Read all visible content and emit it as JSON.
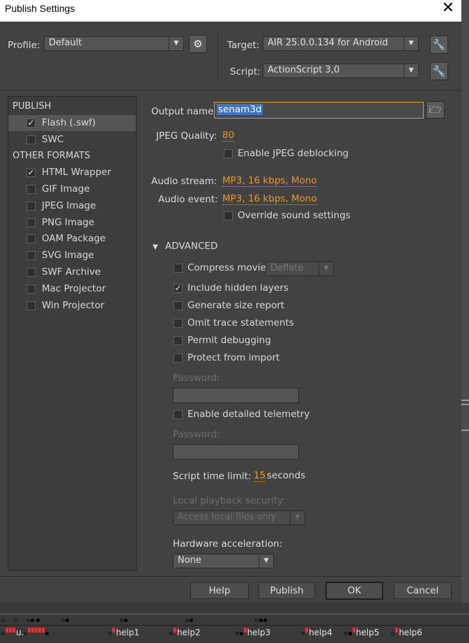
{
  "window": {
    "title": "Publish Settings"
  },
  "header": {
    "profile_label": "Profile:",
    "profile_value": "Default",
    "target_label": "Target:",
    "target_value": "AIR 25.0.0.134 for Android",
    "script_label": "Script:",
    "script_value": "ActionScript 3,0"
  },
  "sidebar": {
    "publish_heading": "PUBLISH",
    "other_heading": "OTHER FORMATS",
    "publish_items": [
      {
        "label": "Flash (.swf)",
        "checked": true,
        "selected": true
      },
      {
        "label": "SWC",
        "checked": false
      }
    ],
    "other_items": [
      {
        "label": "HTML Wrapper",
        "checked": true
      },
      {
        "label": "GIF Image",
        "checked": false
      },
      {
        "label": "JPEG Image",
        "checked": false
      },
      {
        "label": "PNG Image",
        "checked": false
      },
      {
        "label": "OAM Package",
        "checked": false
      },
      {
        "label": "SVG Image",
        "checked": false
      },
      {
        "label": "SWF Archive",
        "checked": false
      },
      {
        "label": "Mac Projector",
        "checked": false
      },
      {
        "label": "Win Projector",
        "checked": false
      }
    ]
  },
  "main": {
    "output_name_label": "Output name:",
    "output_name_value": "senam3d",
    "jpeg_quality_label": "JPEG Quality:",
    "jpeg_quality_value": "80",
    "jpeg_deblocking_label": "Enable JPEG deblocking",
    "audio_stream_label": "Audio stream:",
    "audio_stream_value": "MP3, 16 kbps, Mono",
    "audio_event_label": "Audio event:",
    "audio_event_value": "MP3, 16 kbps, Mono",
    "override_sound_label": "Override sound settings",
    "advanced_heading": "ADVANCED",
    "compress_movie_label": "Compress movie",
    "compress_movie_value": "Deflate",
    "options": [
      {
        "label": "Include hidden layers",
        "checked": true
      },
      {
        "label": "Generate size report",
        "checked": false
      },
      {
        "label": "Omit trace statements",
        "checked": false
      },
      {
        "label": "Permit debugging",
        "checked": false
      },
      {
        "label": "Protect from import",
        "checked": false
      }
    ],
    "password_label": "Password:",
    "telemetry_label": "Enable detailed telemetry",
    "password2_label": "Password:",
    "script_time_limit_label": "Script time limit:",
    "script_time_limit_value": "15",
    "script_time_limit_unit": "seconds",
    "local_playback_label": "Local playback security:",
    "local_playback_value": "Access local files only",
    "hw_accel_label": "Hardware acceleration:",
    "hw_accel_value": "None"
  },
  "footer": {
    "help": "Help",
    "publish": "Publish",
    "ok": "OK",
    "cancel": "Cancel"
  },
  "timeline": {
    "labels": [
      "u.",
      "help1",
      "help2",
      "help3",
      "help4",
      "help5",
      "help6"
    ]
  },
  "colors": {
    "accent_orange": "#e79b1f",
    "selection_blue": "#3a74c7",
    "dialog_bg": "#424242"
  }
}
